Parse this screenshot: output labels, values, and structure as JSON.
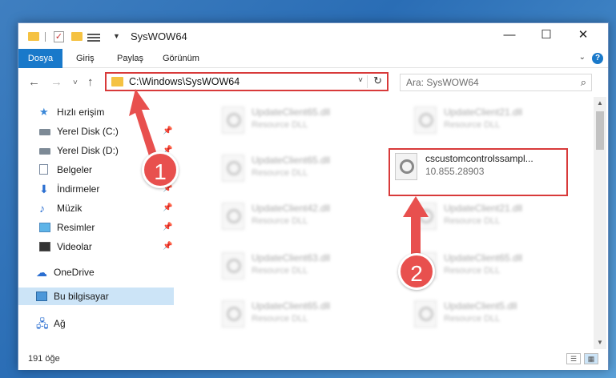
{
  "window": {
    "title": "SysWOW64",
    "minimize_glyph": "—",
    "maximize_glyph": "☐",
    "close_glyph": "✕"
  },
  "ribbon": {
    "tabs": [
      "Dosya",
      "Giriş",
      "Paylaş",
      "Görünüm"
    ],
    "help_glyph": "?"
  },
  "nav": {
    "address": "C:\\Windows\\SysWOW64",
    "search_placeholder": "Ara: SysWOW64"
  },
  "sidebar": {
    "items": [
      {
        "label": "Hızlı erişim",
        "icon": "star-icon"
      },
      {
        "label": "Yerel Disk (C:)",
        "icon": "disk-icon"
      },
      {
        "label": "Yerel Disk (D:)",
        "icon": "disk-icon"
      },
      {
        "label": "Belgeler",
        "icon": "document-icon"
      },
      {
        "label": "İndirmeler",
        "icon": "download-icon"
      },
      {
        "label": "Müzik",
        "icon": "music-icon"
      },
      {
        "label": "Resimler",
        "icon": "pictures-icon"
      },
      {
        "label": "Videolar",
        "icon": "video-icon"
      },
      {
        "label": "OneDrive",
        "icon": "cloud-icon"
      },
      {
        "label": "Bu bilgisayar",
        "icon": "computer-icon"
      },
      {
        "label": "Ağ",
        "icon": "network-icon"
      }
    ]
  },
  "files": [
    {
      "name": "UpdateClient65.dll",
      "sub": "Resource DLL"
    },
    {
      "name": "UpdateClient21.dll",
      "sub": "Resource DLL"
    },
    {
      "name": "UpdateClient65.dll",
      "sub": "Resource DLL"
    },
    {
      "name": "cscustomcontrolssampl...",
      "sub": "10.855.28903"
    },
    {
      "name": "UpdateClient42.dll",
      "sub": "Resource DLL"
    },
    {
      "name": "UpdateClient21.dll",
      "sub": "Resource DLL"
    },
    {
      "name": "UpdateClient63.dll",
      "sub": "Resource DLL"
    },
    {
      "name": "UpdateClient65.dll",
      "sub": "Resource DLL"
    },
    {
      "name": "UpdateClient65.dll",
      "sub": "Resource DLL"
    },
    {
      "name": "UpdateClient5.dll",
      "sub": "Resource DLL"
    }
  ],
  "status": {
    "item_count": "191 öğe"
  },
  "annotations": {
    "step1": "1",
    "step2": "2",
    "color": "#e8504e"
  }
}
